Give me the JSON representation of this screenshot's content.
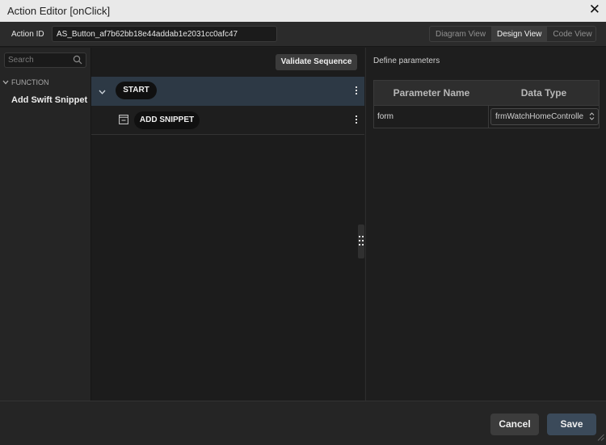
{
  "window": {
    "title": "Action Editor [onClick]",
    "close_glyph": "✕"
  },
  "id_bar": {
    "label": "Action ID",
    "value": "AS_Button_af7b62bb18e44addab1e2031cc0afc47",
    "views": [
      "Diagram View",
      "Design View",
      "Code View"
    ],
    "active_view": "Design View"
  },
  "sidebar": {
    "search_placeholder": "Search",
    "group": "FUNCTION",
    "items": [
      {
        "label": "Add Swift Snippet"
      }
    ]
  },
  "sequence": {
    "validate_label": "Validate Sequence",
    "start_label": "START",
    "snippet_label": "ADD SNIPPET",
    "accent_row_color": "#2d3945"
  },
  "params": {
    "title": "Define parameters",
    "columns": [
      "Parameter Name",
      "Data Type"
    ],
    "rows": [
      {
        "name": "form",
        "type": "frmWatchHomeControlle"
      }
    ]
  },
  "footer": {
    "cancel_label": "Cancel",
    "save_label": "Save",
    "save_color": "#3b4a5a"
  },
  "icons": [
    "close-icon",
    "search-icon",
    "chevron-down-icon",
    "kebab-menu-icon",
    "snippet-icon",
    "select-arrows-icon",
    "drag-handle-icon",
    "resize-grip-icon"
  ]
}
